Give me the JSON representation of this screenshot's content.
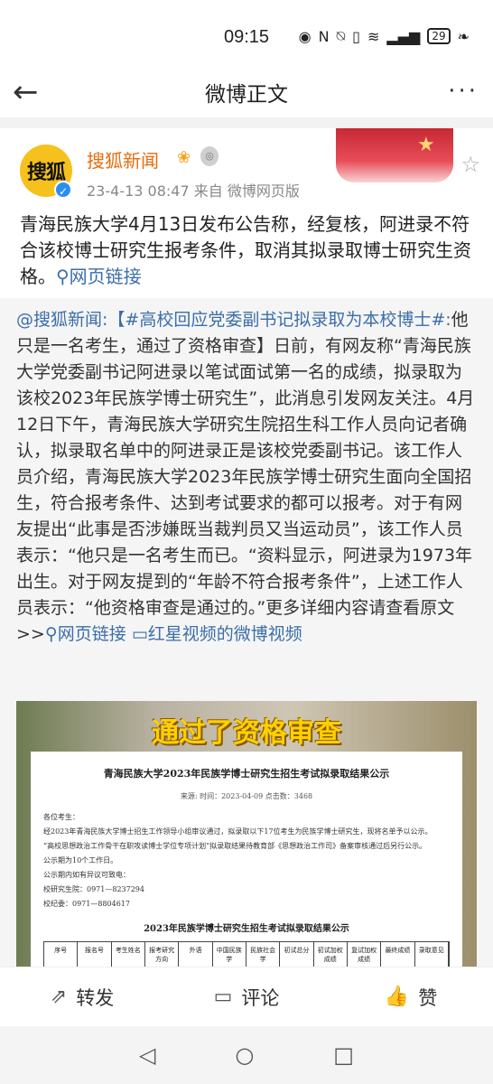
{
  "status": {
    "time": "09:15",
    "battery": "29",
    "icons": [
      "eye-icon",
      "nfc-icon",
      "mute-icon",
      "vibrate-icon",
      "wifi-icon",
      "signal-icon",
      "battery-icon",
      "leaf-icon"
    ]
  },
  "nav": {
    "title": "微博正文",
    "back_icon": "←",
    "more_icon": "···"
  },
  "post": {
    "author": "搜狐新闻",
    "avatar_logo": "搜狐",
    "verify_icon": "✓",
    "meta": "23-4-13 08:47  来自 微博网页版",
    "text": "青海民族大学4月13日发布公告称，经复核，阿进录不符合该校博士研究生报考条件，取消其拟录取博士研究生资格。",
    "link_label": "网页链接"
  },
  "repost": {
    "mention": "@搜狐新闻:",
    "topic": "【#高校回应党委副书记拟录取为本校博士#:",
    "body": "他只是一名考生，通过了资格审查】日前，有网友称“青海民族大学党委副书记阿进录以笔试面试第一名的成绩，拟录取为该校2023年民族学博士研究生”，此消息引发网友关注。4月12日下午，青海民族大学研究生院招生科工作人员向记者确认，拟录取名单中的阿进录正是该校党委副书记。该工作人员介绍，青海民族大学2023年民族学博士研究生面向全国招生，符合报考条件、达到考试要求的都可以报考。对于有网友提出“此事是否涉嫌既当裁判员又当运动员”，该工作人员表示：“他只是一名考生而已。“资料显示，阿进录为1973年出生。对于网友提到的“年龄不符合报考条件”，上述工作人员表示：“他资格审查是通过的。”更多详细内容请查看原文>>",
    "link1": "网页链接",
    "link2": "红星视频的微博视频"
  },
  "media": {
    "caption": "通过了资格审查",
    "doc_title": "青海民族大学2023年民族学博士研究生招生考试拟录取结果公示",
    "doc_sub": "来源:   时间：2023-04-09   点击数：3468",
    "doc_lines": [
      "各位考生：",
      "经2023年青海民族大学博士招生工作领导小组审议通过，拟录取以下17位考生为民族学博士研究生，现将名单予以公示。",
      "“高校思想政治工作骨干在职攻读博士学位专项计划”拟录取结果待教育部《思想政治工作司》备案审核通过后另行公示。",
      "公示期为10个工作日。",
      "公示期内如有异议可致电：",
      "校研究生院：0971—8237294",
      "校纪委：0971—8804617"
    ],
    "table_title": "2023年民族学博士研究生招生考试拟录取结果公示",
    "table_headers": [
      "序号",
      "报名号",
      "考生姓名",
      "报考研究方向",
      "外语",
      "中国民族学",
      "民族社会学",
      "初试总分",
      "初试加权成绩",
      "复试加权成绩",
      "最终成绩",
      "录取意见"
    ]
  },
  "actions": {
    "repost": "转发",
    "comment": "评论",
    "like": "赞"
  }
}
